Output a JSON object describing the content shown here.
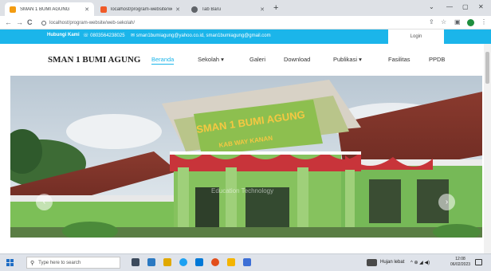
{
  "browser": {
    "tabs": [
      {
        "title": "SMAN 1 BUMI AGUNG",
        "favicon_color": "#f39c12",
        "active": true
      },
      {
        "title": "localhost/program-website/web-",
        "favicon_color": "#f05a28",
        "active": false
      },
      {
        "title": "Tab Baru",
        "favicon_color": "#5f6368",
        "active": false
      }
    ],
    "new_tab": "+",
    "window_controls": {
      "minimize": "—",
      "maximize": "▢",
      "close": "✕",
      "dropdown": "⌄"
    },
    "nav": {
      "back": "←",
      "forward": "→",
      "reload": "C"
    },
    "url": "localhost/program-website/web-sekolah/",
    "toolbar_icons": [
      "share-icon",
      "star-icon",
      "sidepanel-icon",
      "profile-icon",
      "menu-icon"
    ]
  },
  "site": {
    "topbar": {
      "label": "Hubungi Kami",
      "phone": "☏ 0803564238025",
      "email": "✉ sman1bumiagung@yahoo.co.id, sman1bumiagung@gmail.com",
      "login": "Login"
    },
    "brand": "SMAN 1 BUMI AGUNG",
    "menu": [
      {
        "label": "Beranda",
        "active": true
      },
      {
        "label": "Sekolah ▾"
      },
      {
        "label": "Galeri"
      },
      {
        "label": "Download"
      },
      {
        "label": "Publikasi ▾"
      },
      {
        "label": "Fasilitas"
      },
      {
        "label": "PPDB"
      }
    ],
    "hero": {
      "sign_line1": "SMAN 1 BUMI AGUNG",
      "sign_line2": "KAB WAY KANAN",
      "watermark": "Education Technology",
      "prev": "‹",
      "next": "›"
    }
  },
  "taskbar": {
    "search_placeholder": "Type here to search",
    "weather": "Hujan lebat",
    "tray_icons": "^ ⊕ ◢ ◀)",
    "time": "12:08",
    "date": "06/02/2023",
    "app_colors": [
      "#3c4a5c",
      "#2b79c2",
      "#e0a800",
      "#1da1f2",
      "#0078d7",
      "#e24e1b",
      "#f4b400",
      "#3d6fd6"
    ]
  },
  "colors": {
    "accent": "#1bb5ea"
  }
}
